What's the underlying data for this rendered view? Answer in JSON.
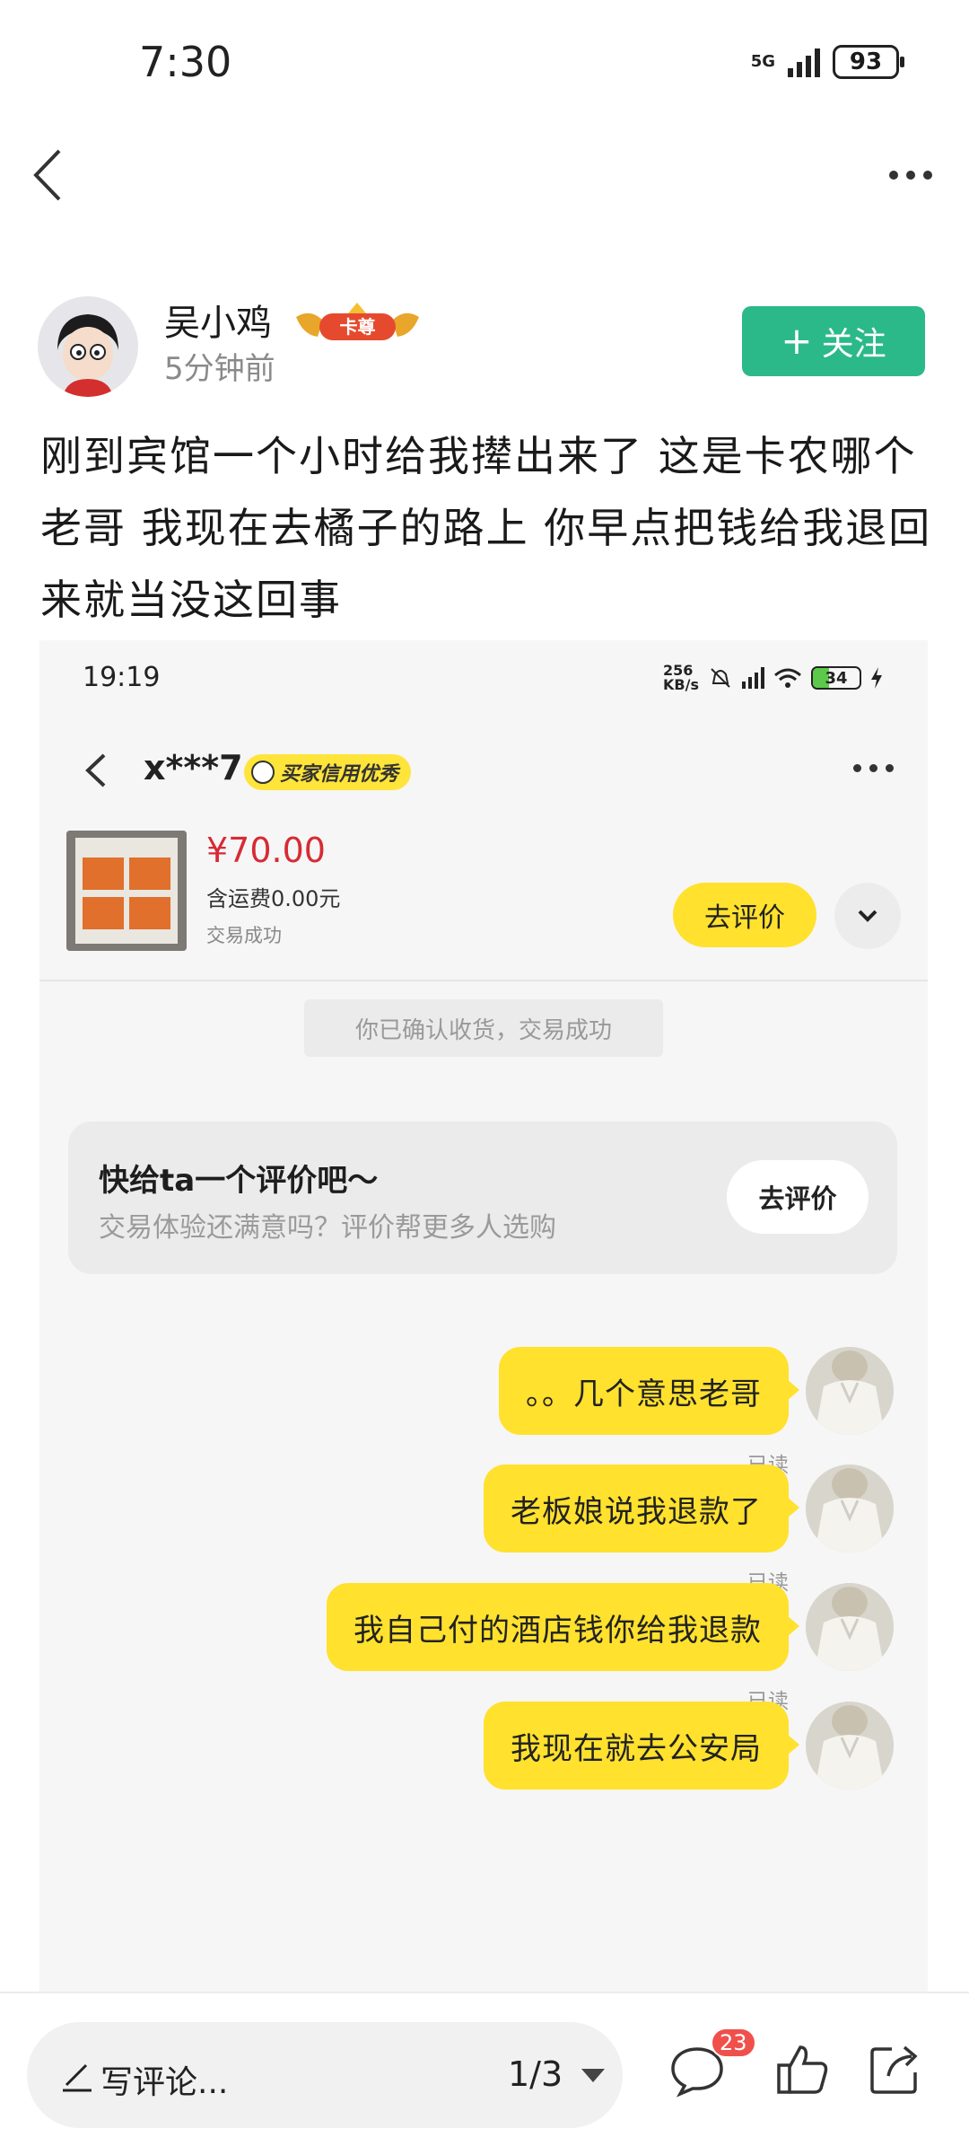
{
  "status_bar": {
    "time": "7:30",
    "network": "5G",
    "battery": "93"
  },
  "post": {
    "author_name": "吴小鸡",
    "author_badge": "卡尊",
    "post_time": "5分钟前",
    "follow_label": "关注",
    "text": "刚到宾馆一个小时给我撵出来了   这是卡农哪个老哥  我现在去橘子的路上  你早点把钱给我退回来就当没这回事"
  },
  "embedded": {
    "status": {
      "time": "19:19",
      "speed_value": "256",
      "speed_unit": "KB/s",
      "battery": "34"
    },
    "chat_user": "x***7",
    "credit_badge": "买家信用优秀",
    "order": {
      "price": "¥70.00",
      "shipping": "含运费0.00元",
      "status": "交易成功",
      "review_button": "去评价"
    },
    "system_message": "你已确认收货，交易成功",
    "review_prompt": {
      "title": "快给ta一个评价吧～",
      "subtitle": "交易体验还满意吗？评价帮更多人选购",
      "button": "去评价"
    },
    "messages": [
      {
        "text": "。。几个意思老哥",
        "status": "已读"
      },
      {
        "text": "老板娘说我退款了",
        "status": "已读"
      },
      {
        "text": "我自己付的酒店钱你给我退款",
        "status": "已读"
      },
      {
        "text": "我现在就去公安局",
        "status": ""
      }
    ]
  },
  "bottom_bar": {
    "comment_placeholder": "写评论...",
    "page_indicator": "1/3",
    "comment_count": "23"
  }
}
